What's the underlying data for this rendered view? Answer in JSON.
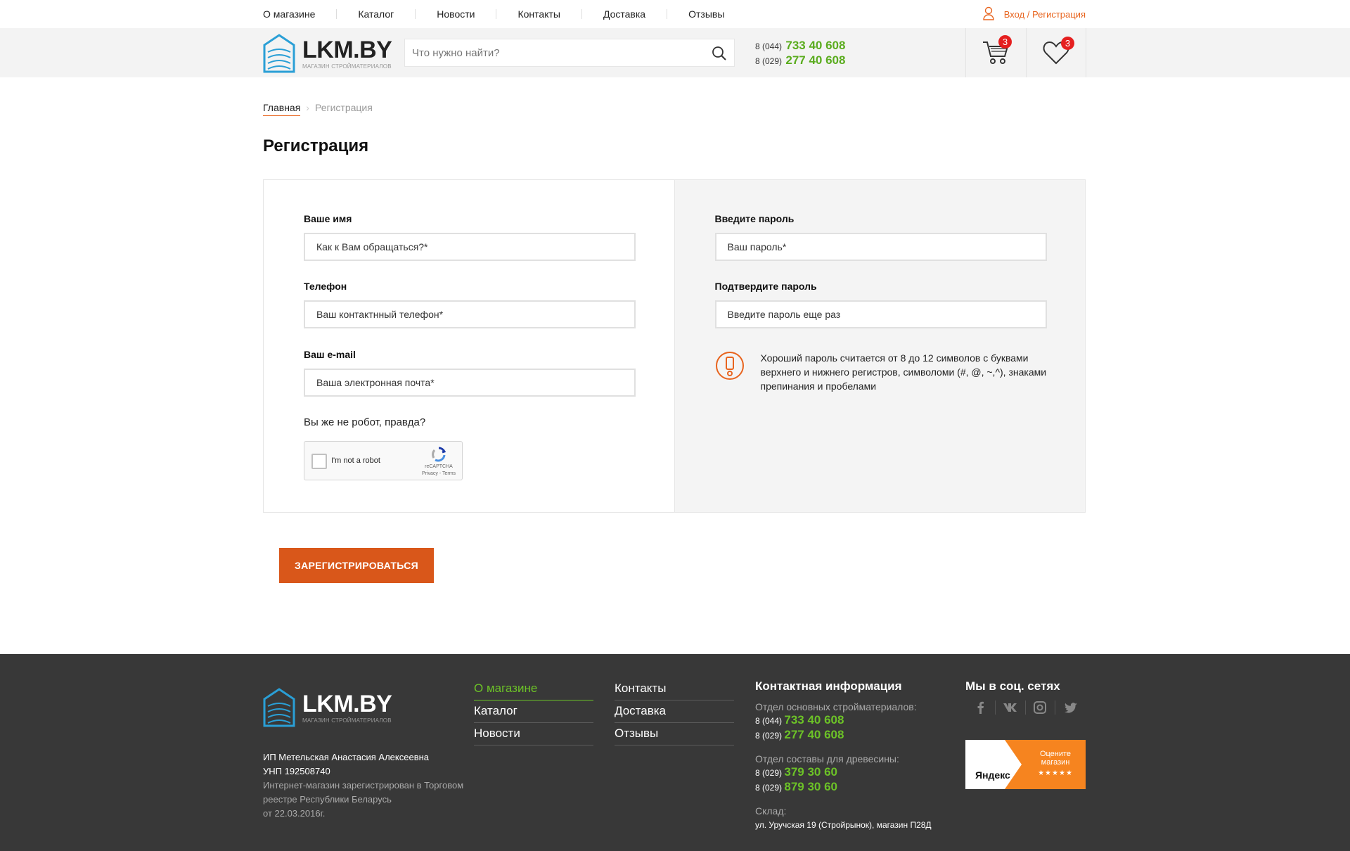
{
  "topnav": {
    "items": [
      "О магазине",
      "Каталог",
      "Новости",
      "Контакты",
      "Доставка",
      "Отзывы"
    ],
    "login_label": "Вход / Регистрация"
  },
  "header": {
    "logo_text": "LKM.BY",
    "logo_tagline": "МАГАЗИН СТРОЙМАТЕРИАЛОВ",
    "search_placeholder": "Что нужно найти?",
    "phones": [
      {
        "code": "8 (044)",
        "number": "733 40 608"
      },
      {
        "code": "8 (029)",
        "number": "277 40 608"
      }
    ],
    "cart_count": "3",
    "fav_count": "3"
  },
  "breadcrumb": {
    "home": "Главная",
    "current": "Регистрация"
  },
  "page_title": "Регистрация",
  "form": {
    "name": {
      "label": "Ваше имя",
      "placeholder": "Как к Вам обращаться?*"
    },
    "phone": {
      "label": "Телефон",
      "placeholder": "Ваш контактнный телефон*"
    },
    "email": {
      "label": "Ваш e-mail",
      "placeholder": "Ваша электронная почта*"
    },
    "password": {
      "label": "Введите пароль",
      "placeholder": "Ваш пароль*"
    },
    "password_confirm": {
      "label": "Подтвердите пароль",
      "placeholder": "Введите пароль еще раз"
    },
    "password_hint": "Хороший пароль считается от 8 до 12 символов с буквами верхнего и нижнего регистров, символоми (#, @, ~,^), знаками препинания и пробелами",
    "robot_question": "Вы же не робот, правда?",
    "captcha_label": "I'm not a robot",
    "captcha_brand": "reCAPTCHA",
    "captcha_links": "Privacy - Terms",
    "submit_label": "ЗАРЕГИСТРИРОВАТЬСЯ"
  },
  "footer": {
    "logo_text": "LKM.BY",
    "logo_tagline": "МАГАЗИН СТРОЙМАТЕРИАЛОВ",
    "legal_name": "ИП Метельская Анастасия Алексеевна",
    "unp": "УНП 192508740",
    "registry": "Интернет-магазин зарегистрирован в Торговом реестре Республики Беларусь",
    "registry_date": "от 22.03.2016г.",
    "menu_col1": [
      "О магазине",
      "Каталог",
      "Новости"
    ],
    "menu_col2": [
      "Контакты",
      "Доставка",
      "Отзывы"
    ],
    "contact_title": "Контактная информация",
    "dept1_label": "Отдел основных стройматериалов:",
    "dept1_phones": [
      {
        "code": "8 (044)",
        "number": "733 40 608"
      },
      {
        "code": "8 (029)",
        "number": "277 40 608"
      }
    ],
    "dept2_label": "Отдел составы для древесины:",
    "dept2_phones": [
      {
        "code": "8 (029)",
        "number": "379 30 60"
      },
      {
        "code": "8 (029)",
        "number": "879 30 60"
      }
    ],
    "warehouse_label": "Склад:",
    "warehouse_address": "ул. Уручская 19 (Стройрынок), магазин П28Д",
    "social_title": "Мы в соц. сетях",
    "yandex_text": "Оцените магазин",
    "yandex_brand": "Яндекс",
    "yandex_stars": "★★★★★"
  },
  "colors": {
    "accent_orange": "#d9571a",
    "accent_green": "#5aac1e",
    "footer_bg": "#383838"
  }
}
